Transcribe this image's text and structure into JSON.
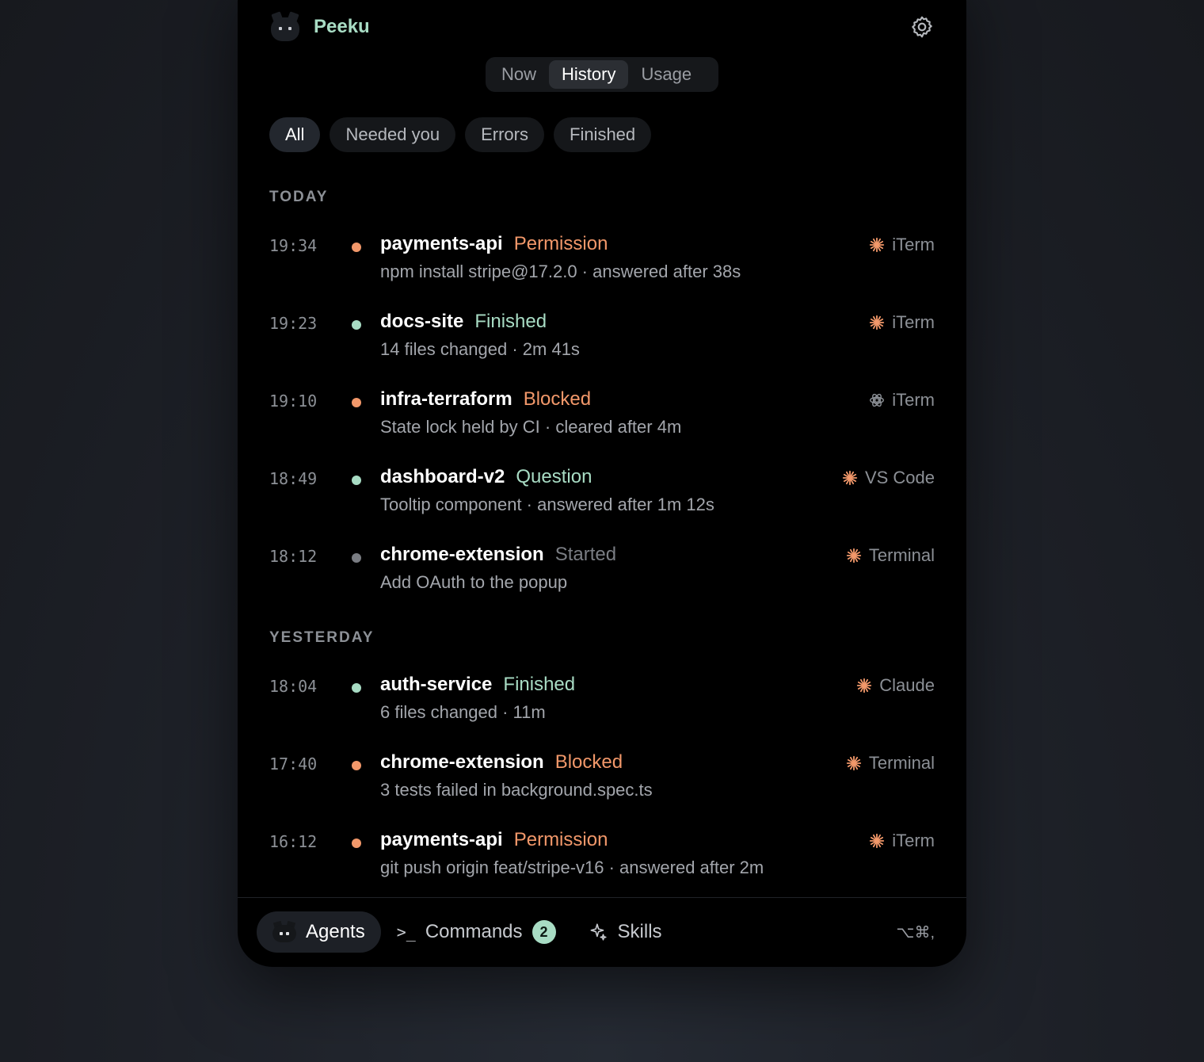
{
  "app": {
    "name": "Peeku"
  },
  "view_tabs": [
    {
      "label": "Now",
      "active": false
    },
    {
      "label": "History",
      "active": true
    },
    {
      "label": "Usage",
      "active": false
    }
  ],
  "filters": [
    {
      "label": "All",
      "active": true
    },
    {
      "label": "Needed you",
      "active": false
    },
    {
      "label": "Errors",
      "active": false
    },
    {
      "label": "Finished",
      "active": false
    }
  ],
  "colors": {
    "warn": "#f2986a",
    "ok": "#a8dcc4",
    "muted": "#7a7d83",
    "accent_spark": "#f2986a"
  },
  "sections": [
    {
      "label": "TODAY",
      "items": [
        {
          "time": "19:34",
          "title": "payments-api",
          "status": "Permission",
          "tone": "warn",
          "sub": "npm install stripe@17.2.0 · answered after 38s",
          "icon": "spark-icon",
          "source": "iTerm"
        },
        {
          "time": "19:23",
          "title": "docs-site",
          "status": "Finished",
          "tone": "ok",
          "sub": "14 files changed · 2m 41s",
          "icon": "spark-icon",
          "source": "iTerm"
        },
        {
          "time": "19:10",
          "title": "infra-terraform",
          "status": "Blocked",
          "tone": "warn",
          "sub": "State lock held by CI · cleared after 4m",
          "icon": "openai-icon",
          "source": "iTerm"
        },
        {
          "time": "18:49",
          "title": "dashboard-v2",
          "status": "Question",
          "tone": "ok",
          "sub": "Tooltip component · answered after 1m 12s",
          "icon": "spark-icon",
          "source": "VS Code"
        },
        {
          "time": "18:12",
          "title": "chrome-extension",
          "status": "Started",
          "tone": "muted",
          "sub": "Add OAuth to the popup",
          "icon": "spark-icon",
          "source": "Terminal"
        }
      ]
    },
    {
      "label": "YESTERDAY",
      "items": [
        {
          "time": "18:04",
          "title": "auth-service",
          "status": "Finished",
          "tone": "ok",
          "sub": "6 files changed · 11m",
          "icon": "spark-icon",
          "source": "Claude"
        },
        {
          "time": "17:40",
          "title": "chrome-extension",
          "status": "Blocked",
          "tone": "warn",
          "sub": "3 tests failed in background.spec.ts",
          "icon": "spark-icon",
          "source": "Terminal"
        },
        {
          "time": "16:12",
          "title": "payments-api",
          "status": "Permission",
          "tone": "warn",
          "sub": "git push origin feat/stripe-v16 · answered after 2m",
          "icon": "spark-icon",
          "source": "iTerm"
        }
      ]
    }
  ],
  "bottom_nav": {
    "agents": "Agents",
    "commands_prompt": ">_",
    "commands": "Commands",
    "commands_badge": "2",
    "skills": "Skills",
    "shortcut": "⌥⌘,"
  }
}
